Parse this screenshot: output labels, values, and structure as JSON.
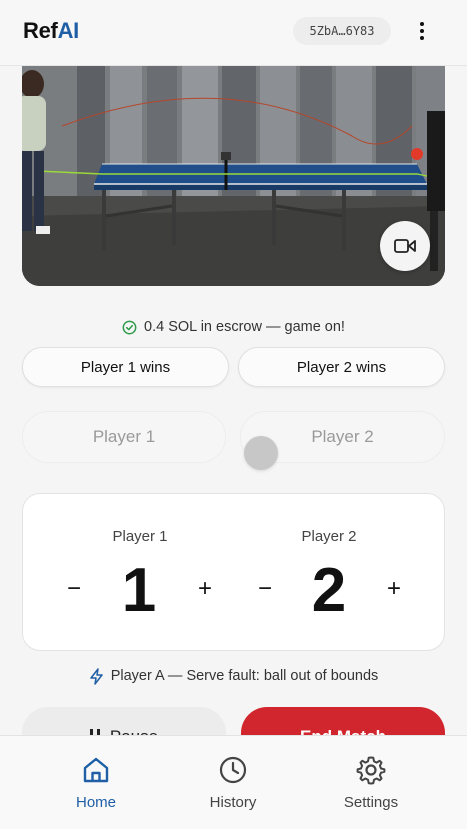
{
  "header": {
    "logo_prefix": "Ref",
    "logo_suffix": "AI",
    "wallet": "5ZbA…6Y83",
    "menu_icon": "more-vertical-icon"
  },
  "video": {
    "camera_icon": "video-camera-icon"
  },
  "escrow": {
    "status_icon": "check-circle-icon",
    "text": "0.4 SOL in escrow — game on!"
  },
  "winner_buttons": {
    "player1": "Player 1 wins",
    "player2": "Player 2 wins"
  },
  "player_selector": {
    "player1": "Player 1",
    "player2": "Player 2"
  },
  "scoreboard": {
    "player1": {
      "name": "Player 1",
      "score": "1"
    },
    "player2": {
      "name": "Player 2",
      "score": "2"
    },
    "minus": "−",
    "plus": "+"
  },
  "last_call": {
    "icon": "lightning-icon",
    "text": "Player A — Serve fault: ball out of bounds"
  },
  "actions": {
    "pause": "Pause",
    "end": "End Match"
  },
  "tabs": [
    {
      "label": "Home",
      "icon": "home-icon",
      "active": true
    },
    {
      "label": "History",
      "icon": "clock-icon",
      "active": false
    },
    {
      "label": "Settings",
      "icon": "gear-icon",
      "active": false
    }
  ],
  "colors": {
    "accent": "#1f5fa5",
    "danger": "#d1262d",
    "success": "#2e9a4a"
  }
}
